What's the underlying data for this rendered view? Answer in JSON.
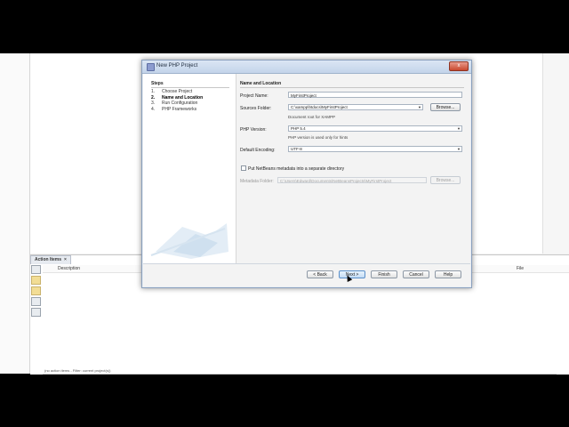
{
  "ide": {
    "action_items": {
      "tab_label": "Action Items",
      "close_glyph": "×",
      "columns": [
        "Description",
        "File"
      ],
      "status_text": "(no action items - Filter: current project(s))"
    }
  },
  "dialog": {
    "title": "New PHP Project",
    "close_glyph": "x",
    "steps": {
      "heading": "Steps",
      "items": [
        {
          "num": "1.",
          "label": "Choose Project"
        },
        {
          "num": "2.",
          "label": "Name and Location"
        },
        {
          "num": "3.",
          "label": "Run Configuration"
        },
        {
          "num": "4.",
          "label": "PHP Frameworks"
        }
      ]
    },
    "content": {
      "heading": "Name and Location",
      "project_name_label": "Project Name:",
      "project_name_value": "MyFirstProject",
      "sources_folder_label": "Sources Folder:",
      "sources_folder_value": "C:\\xampp\\htdocs\\MyFirstProject",
      "browse_label": "Browse...",
      "sources_hint": "Document root for XAMPP",
      "php_version_label": "PHP Version:",
      "php_version_value": "PHP 5.4",
      "php_version_hint": "PHP version is used only for hints",
      "encoding_label": "Default Encoding:",
      "encoding_value": "UTF-8",
      "separate_metadata_label": "Put NetBeans metadata into a separate directory",
      "metadata_folder_label": "Metadata Folder:",
      "metadata_folder_value": "C:\\Users\\Edward\\Documents\\NetBeansProjects\\MyFirstProject",
      "browse2_label": "Browse..."
    },
    "buttons": {
      "back": "< Back",
      "next": "Next >",
      "finish": "Finish",
      "cancel": "Cancel",
      "help": "Help"
    }
  }
}
